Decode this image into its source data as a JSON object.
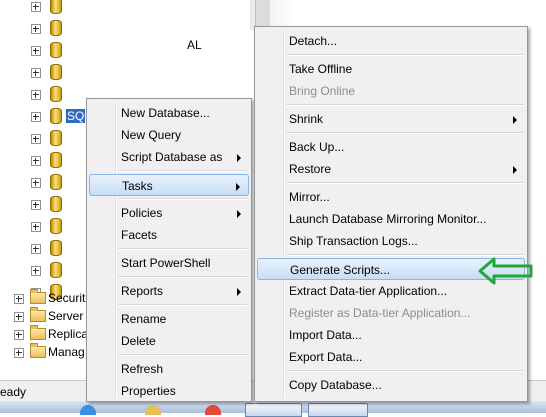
{
  "tree": {
    "db_rows": 14,
    "selected_node_text": "SQ",
    "fragment_text": "AL",
    "folders": [
      {
        "label": "Securit"
      },
      {
        "label": "Server"
      },
      {
        "label": "Replica"
      },
      {
        "label": "Manag"
      }
    ]
  },
  "context_menu": {
    "items": [
      {
        "label": "New Database...",
        "type": "item"
      },
      {
        "label": "New Query",
        "type": "item"
      },
      {
        "label": "Script Database as",
        "type": "item",
        "submenu": true
      },
      {
        "type": "sep"
      },
      {
        "label": "Tasks",
        "type": "item",
        "submenu": true,
        "highlighted": true
      },
      {
        "type": "sep"
      },
      {
        "label": "Policies",
        "type": "item",
        "submenu": true
      },
      {
        "label": "Facets",
        "type": "item"
      },
      {
        "type": "sep"
      },
      {
        "label": "Start PowerShell",
        "type": "item"
      },
      {
        "type": "sep"
      },
      {
        "label": "Reports",
        "type": "item",
        "submenu": true
      },
      {
        "type": "sep"
      },
      {
        "label": "Rename",
        "type": "item"
      },
      {
        "label": "Delete",
        "type": "item"
      },
      {
        "type": "sep"
      },
      {
        "label": "Refresh",
        "type": "item"
      },
      {
        "label": "Properties",
        "type": "item"
      }
    ]
  },
  "tasks_menu": {
    "items": [
      {
        "label": "Detach...",
        "type": "item"
      },
      {
        "type": "sep"
      },
      {
        "label": "Take Offline",
        "type": "item"
      },
      {
        "label": "Bring Online",
        "type": "item",
        "disabled": true
      },
      {
        "type": "sep"
      },
      {
        "label": "Shrink",
        "type": "item",
        "submenu": true
      },
      {
        "type": "sep"
      },
      {
        "label": "Back Up...",
        "type": "item"
      },
      {
        "label": "Restore",
        "type": "item",
        "submenu": true
      },
      {
        "type": "sep"
      },
      {
        "label": "Mirror...",
        "type": "item"
      },
      {
        "label": "Launch Database Mirroring Monitor...",
        "type": "item"
      },
      {
        "label": "Ship Transaction Logs...",
        "type": "item"
      },
      {
        "type": "sep"
      },
      {
        "label": "Generate Scripts...",
        "type": "item",
        "highlighted": true
      },
      {
        "label": "Extract Data-tier Application...",
        "type": "item"
      },
      {
        "label": "Register as Data-tier Application...",
        "type": "item",
        "disabled": true
      },
      {
        "label": "Import Data...",
        "type": "item"
      },
      {
        "label": "Export Data...",
        "type": "item"
      },
      {
        "type": "sep"
      },
      {
        "label": "Copy Database...",
        "type": "item"
      }
    ]
  },
  "status_bar": {
    "text": "eady"
  },
  "colors": {
    "callout_arrow": "#22a83a",
    "highlight": "#c7def5"
  },
  "icons": [
    "plus-expander-icon",
    "database-icon",
    "folder-icon",
    "submenu-arrow-icon",
    "green-arrow-icon"
  ]
}
